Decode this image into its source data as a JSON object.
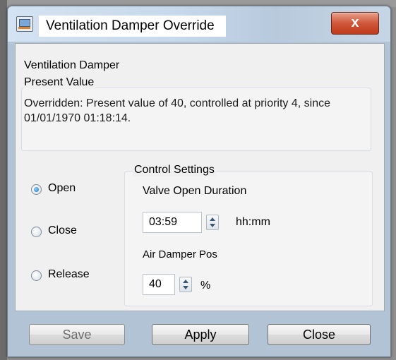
{
  "window": {
    "title": "Ventilation Damper Override",
    "close_glyph": "x"
  },
  "damper_name": "Ventilation Damper",
  "present_value": {
    "legend": "Present Value",
    "text": "Overridden: Present value of 40, controlled at priority 4, since 01/01/1970 01:18:14."
  },
  "options": [
    {
      "label": "Open",
      "checked": true
    },
    {
      "label": "Close",
      "checked": false
    },
    {
      "label": "Release",
      "checked": false
    }
  ],
  "control_settings": {
    "legend": "Control Settings",
    "valve_label": "Valve Open Duration",
    "valve_value": "03:59",
    "valve_unit": "hh:mm",
    "air_label": "Air Damper Pos",
    "air_value": "40",
    "air_unit": "%"
  },
  "buttons": {
    "save": "Save",
    "apply": "Apply",
    "close": "Close"
  },
  "icons": {
    "app": "computer-icon",
    "close": "close-icon",
    "spin": "spin-arrows-icon"
  }
}
